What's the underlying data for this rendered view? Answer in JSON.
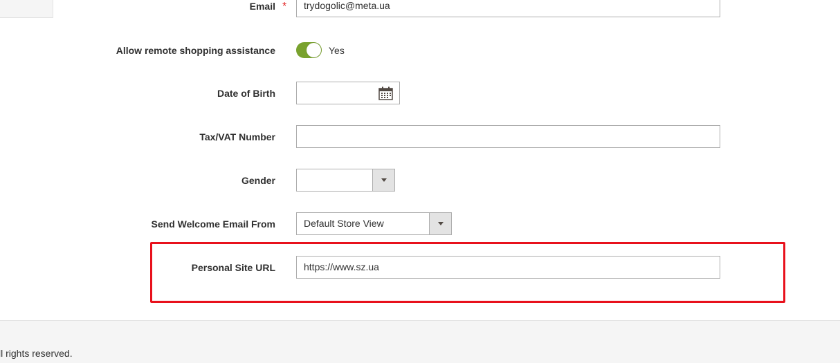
{
  "form": {
    "email": {
      "label": "Email",
      "required_mark": "*",
      "value": "trydogolic@meta.ua"
    },
    "remote_assistance": {
      "label": "Allow remote shopping assistance",
      "state_label": "Yes",
      "enabled": true
    },
    "dob": {
      "label": "Date of Birth",
      "value": "",
      "icon": "calendar-icon"
    },
    "taxvat": {
      "label": "Tax/VAT Number",
      "value": ""
    },
    "gender": {
      "label": "Gender",
      "selected": ""
    },
    "welcome_from": {
      "label": "Send Welcome Email From",
      "selected": "Default Store View"
    },
    "personal_site": {
      "label": "Personal Site URL",
      "value": "https://www.sz.ua"
    }
  },
  "colors": {
    "toggle_on": "#79a22e",
    "highlight": "#e8111c",
    "required": "#e22626"
  },
  "footer": {
    "text": "ll rights reserved."
  }
}
